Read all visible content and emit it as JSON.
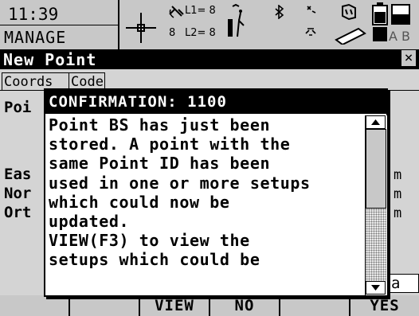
{
  "status": {
    "time": "11:39",
    "mode": "MANAGE",
    "l1_label": "L1= 8",
    "l2_label": "L2= 8",
    "sat_count": "8",
    "icons": [
      "crosshair-icon",
      "satellite-icon",
      "antenna-icon",
      "bluetooth-icon",
      "radio-icon",
      "card-icon",
      "battery-icon"
    ],
    "ab_label": "A B"
  },
  "titlebar": {
    "title": "New Point",
    "close": "×"
  },
  "tabs": [
    {
      "label": "Coords"
    },
    {
      "label": "Code"
    }
  ],
  "form": {
    "labels": [
      "Poi",
      "Eas",
      "Nor",
      "Ort"
    ],
    "units": [
      "m",
      "m",
      "m"
    ]
  },
  "input_mode": "a",
  "dialog": {
    "title": "CONFIRMATION: 1100",
    "message": "Point BS has just been\nstored. A point with the\nsame Point ID has been\nused in one or more setups\nwhich could now be\nupdated.\nVIEW(F3) to view the\nsetups which could be"
  },
  "softkeys": [
    {
      "label": ""
    },
    {
      "label": ""
    },
    {
      "label": "VIEW"
    },
    {
      "label": "NO"
    },
    {
      "label": ""
    },
    {
      "label": "YES"
    }
  ]
}
